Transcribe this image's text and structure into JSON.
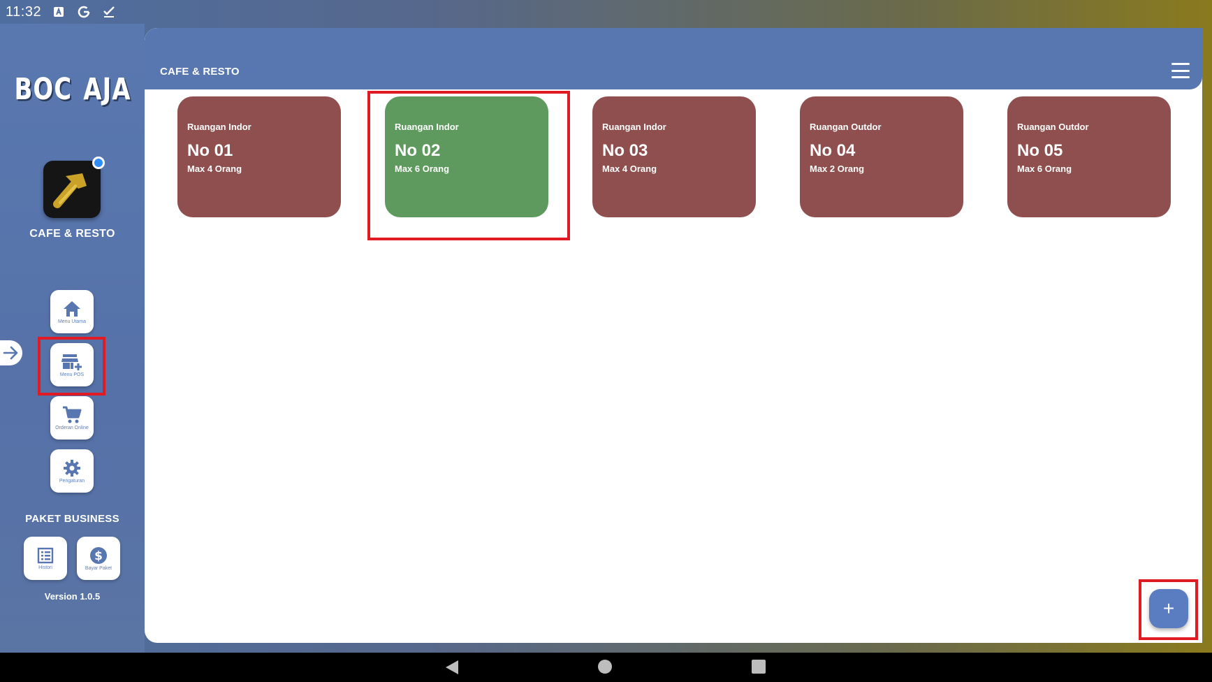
{
  "status_bar": {
    "time": "11:32",
    "icons": [
      "a-icon",
      "google-icon",
      "check-icon"
    ]
  },
  "sidebar": {
    "brand_left": "BOC",
    "brand_right": "AJA",
    "shop_name": "CAFE & RESTO",
    "nav_items": [
      {
        "label": "Menu Utama",
        "icon": "home-icon"
      },
      {
        "label": "Menu POS",
        "icon": "store-add-icon"
      },
      {
        "label": "Orderan Online",
        "icon": "cart-icon"
      },
      {
        "label": "Pengaturan",
        "icon": "gear-icon"
      }
    ],
    "paket_title": "PAKET BUSINESS",
    "paket_items": [
      {
        "label": "Histori",
        "icon": "list-icon"
      },
      {
        "label": "Bayar Paket",
        "icon": "dollar-icon"
      }
    ],
    "version": "Version 1.0.5"
  },
  "main": {
    "title": "CAFE & RESTO",
    "rooms": [
      {
        "type": "Ruangan Indor",
        "number": "No 01",
        "capacity": "Max 4 Orang",
        "status": "busy"
      },
      {
        "type": "Ruangan Indor",
        "number": "No 02",
        "capacity": "Max 6 Orang",
        "status": "free"
      },
      {
        "type": "Ruangan Indor",
        "number": "No 03",
        "capacity": "Max 4 Orang",
        "status": "busy"
      },
      {
        "type": "Ruangan Outdor",
        "number": "No 04",
        "capacity": "Max 2 Orang",
        "status": "busy"
      },
      {
        "type": "Ruangan Outdor",
        "number": "No 05",
        "capacity": "Max 6 Orang",
        "status": "busy"
      }
    ],
    "fab_label": "+"
  },
  "colors": {
    "sidebar_blue": "#5877b0",
    "room_busy": "#8f4f4f",
    "room_free": "#5e9a5e",
    "highlight_red": "#e01b24"
  }
}
